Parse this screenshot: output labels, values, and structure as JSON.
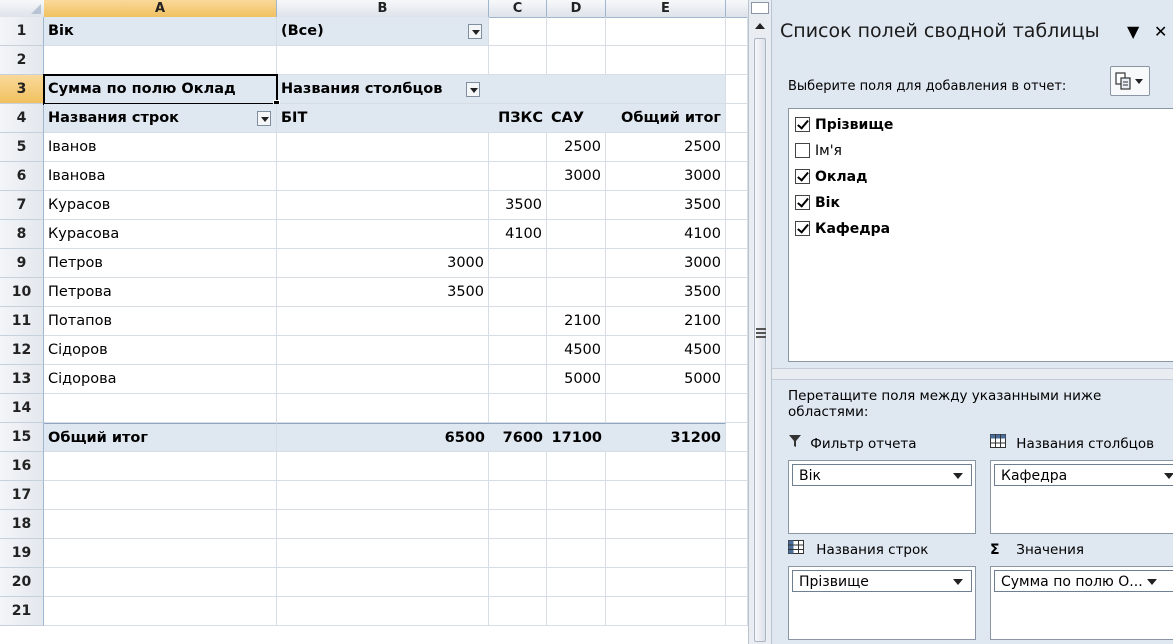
{
  "sheet": {
    "columns": [
      "A",
      "B",
      "C",
      "D",
      "E"
    ],
    "rows": [
      "1",
      "2",
      "3",
      "4",
      "5",
      "6",
      "7",
      "8",
      "9",
      "10",
      "11",
      "12",
      "13",
      "14",
      "15",
      "16",
      "17",
      "18",
      "19",
      "20",
      "21"
    ],
    "filter": {
      "label": "Вік",
      "value": "(Все)"
    },
    "pivot": {
      "values_caption": "Сумма по полю Оклад",
      "column_labels_caption": "Названия столбцов",
      "row_labels_caption": "Названия строк",
      "column_headers": [
        "БІТ",
        "ПЗКС",
        "САУ",
        "Общий итог"
      ],
      "rows": [
        {
          "name": "Іванов",
          "bit": "",
          "pzks": "",
          "sau": "2500",
          "total": "2500"
        },
        {
          "name": "Іванова",
          "bit": "",
          "pzks": "",
          "sau": "3000",
          "total": "3000"
        },
        {
          "name": "Курасов",
          "bit": "",
          "pzks": "3500",
          "sau": "",
          "total": "3500"
        },
        {
          "name": "Курасова",
          "bit": "",
          "pzks": "4100",
          "sau": "",
          "total": "4100"
        },
        {
          "name": "Петров",
          "bit": "3000",
          "pzks": "",
          "sau": "",
          "total": "3000"
        },
        {
          "name": "Петрова",
          "bit": "3500",
          "pzks": "",
          "sau": "",
          "total": "3500"
        },
        {
          "name": "Потапов",
          "bit": "",
          "pzks": "",
          "sau": "2100",
          "total": "2100"
        },
        {
          "name": "Сідоров",
          "bit": "",
          "pzks": "",
          "sau": "4500",
          "total": "4500"
        },
        {
          "name": "Сідорова",
          "bit": "",
          "pzks": "",
          "sau": "5000",
          "total": "5000"
        }
      ],
      "grand_total": {
        "name": "Общий итог",
        "bit": "6500",
        "pzks": "7600",
        "sau": "17100",
        "total": "31200"
      }
    }
  },
  "pane": {
    "title": "Список полей сводной таблицы",
    "choose_label": "Выберите поля для добавления в отчет:",
    "fields": [
      {
        "label": "Прізвище",
        "checked": true
      },
      {
        "label": "Ім'я",
        "checked": false
      },
      {
        "label": "Оклад",
        "checked": true
      },
      {
        "label": "Вік",
        "checked": true
      },
      {
        "label": "Кафедра",
        "checked": true
      }
    ],
    "drag_label": "Перетащите поля между указанными ниже областями:",
    "areas": {
      "report_filter": {
        "title": "Фильтр отчета",
        "icon": "filter-icon",
        "value": "Вік"
      },
      "column_labels": {
        "title": "Названия столбцов",
        "icon": "table-columns-icon",
        "value": "Кафедра"
      },
      "row_labels": {
        "title": "Названия строк",
        "icon": "table-rows-icon",
        "value": "Прізвище"
      },
      "values": {
        "title": "Значения",
        "icon": "sigma-icon",
        "value": "Сумма по полю О..."
      }
    }
  }
}
